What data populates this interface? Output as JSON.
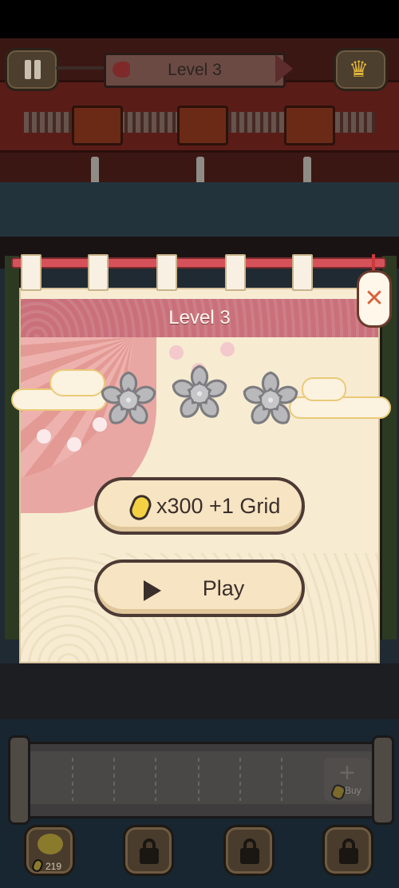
{
  "hud": {
    "level_banner": "Level 3"
  },
  "dialog": {
    "title": "Level 3",
    "stars_earned": 0,
    "stars_total": 3,
    "grid_button": {
      "cost": "x300",
      "reward": "+1 Grid",
      "label": "x300 +1 Grid"
    },
    "play_button": {
      "label": "Play"
    }
  },
  "shelf": {
    "buy_label": "Buy"
  },
  "bottom_bar": {
    "coin_count": "219",
    "locked_slots": 3
  },
  "icons": {
    "pause": "pause-icon",
    "crown": "crown-icon",
    "close": "close-icon",
    "star": "sakura-star-icon",
    "coin": "coin-icon",
    "play": "play-icon",
    "lock": "lock-icon",
    "pig": "piggy-bank-icon"
  },
  "colors": {
    "header_pink": "#c9707a",
    "modal_bg": "#f7ecd2",
    "button_bg": "#f7e4c2",
    "button_border": "#4d3a34",
    "coin_yellow": "#f3d143",
    "close_orange": "#d8623a"
  }
}
